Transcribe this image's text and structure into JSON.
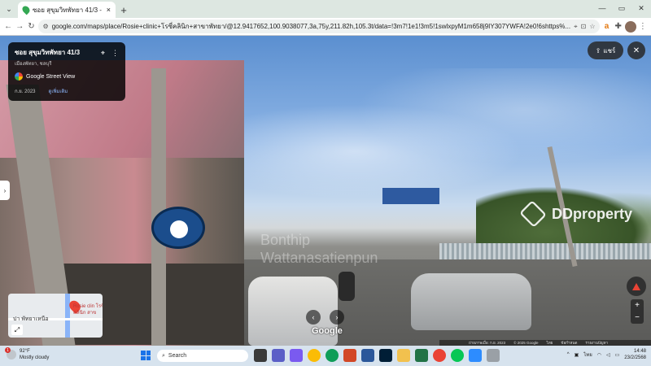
{
  "browser": {
    "tab_title": "ซอย สุขุมวิทพัทยา 41/3 - Google",
    "tab_close": "×",
    "new_tab": "+",
    "tab_search": "⌄",
    "window_minimize": "—",
    "window_restore": "▭",
    "window_close": "✕",
    "url": "google.com/maps/place/Rosie+clinic+โรซี่คลินิก+สาขาพัทยา/@12.9417652,100.9038077,3a,75y,211.82h,105.3t/data=!3m7!1e1!3m5!1swlxpyM1m658j9IY307YWFA!2e0!6shttps%...",
    "back": "←",
    "forward": "→",
    "reload": "↻"
  },
  "streetview": {
    "place_title": "ซอย สุขุมวิทพัทยา 41/3",
    "place_subtitle": "เมืองพัทยา, ชลบุรี",
    "source": "Google Street View",
    "date": "ก.ย. 2023",
    "see_more": "ดูเพิ่มเติม",
    "share_label": "แชร์",
    "close": "✕",
    "side_toggle": "›",
    "prev": "‹",
    "next": "›",
    "brand": "Google",
    "zoom_in": "+",
    "zoom_out": "−",
    "watermark_line1": "Bonthip",
    "watermark_line2": "Wattanasatienpun",
    "watermark_brand": "DDproperty"
  },
  "minimap": {
    "label_left": "ปา พัทยาเหนือ",
    "label_right": "Rosie clin โรซี่คลินิก สาข",
    "expand": "⤢"
  },
  "attribution": {
    "capture": "ถ่ายภาพเมื่อ: ก.ย. 2023",
    "copyright": "© 2025 Google",
    "terms": "ไทย",
    "privacy": "ข้อกำหนด",
    "report": "รายงานปัญหา"
  },
  "taskbar": {
    "temp": "92°F",
    "weather_desc": "Mostly cloudy",
    "badge": "1",
    "search_placeholder": "Search",
    "lang": "ไทย",
    "time": "14:48",
    "date": "23/2/2568"
  },
  "colors": {
    "accent": "#1a73e8",
    "brand_red": "#ea4335"
  }
}
